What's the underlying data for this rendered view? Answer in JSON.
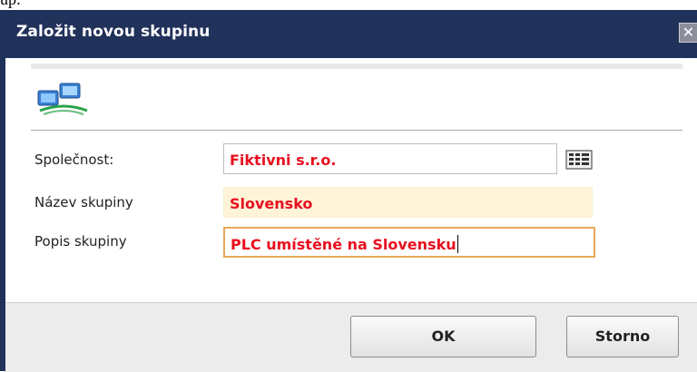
{
  "caption": "up:",
  "dialog": {
    "title": "Založit novou skupinu",
    "close_glyph": "✕",
    "icon": "network-computers-icon"
  },
  "form": {
    "company_label": "Společnost:",
    "company_value": "Fiktivni s.r.o.",
    "group_name_label": "Název skupiny",
    "group_name_value": "Slovensko",
    "group_desc_label": "Popis skupiny",
    "group_desc_value": "PLC umístěné na Slovensku",
    "lookup_icon": "lookup-grid-icon"
  },
  "buttons": {
    "ok_label": "OK",
    "cancel_label": "Storno"
  },
  "colors": {
    "titlebar": "#21325a",
    "field_text": "#e8101f",
    "active_field_border": "#e8a857",
    "readonly_field_bg": "#fff4d8"
  }
}
